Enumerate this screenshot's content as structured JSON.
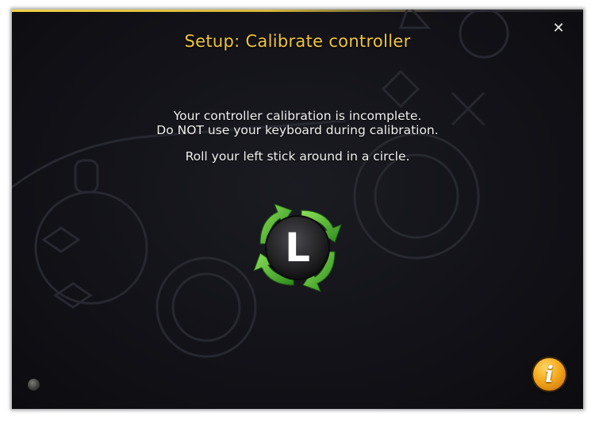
{
  "dialog": {
    "title": "Setup: Calibrate controller",
    "close_glyph": "✕",
    "message_line_1": "Your controller calibration is incomplete.",
    "message_line_2": "Do NOT use your keyboard during calibration.",
    "instruction": "Roll your left stick around in a circle.",
    "stick_letter": "L",
    "stick_icon": "left-stick-rotate-icon",
    "info_glyph": "i",
    "accent_color": "#f0c43c",
    "arrow_color": "#3fae2a"
  }
}
